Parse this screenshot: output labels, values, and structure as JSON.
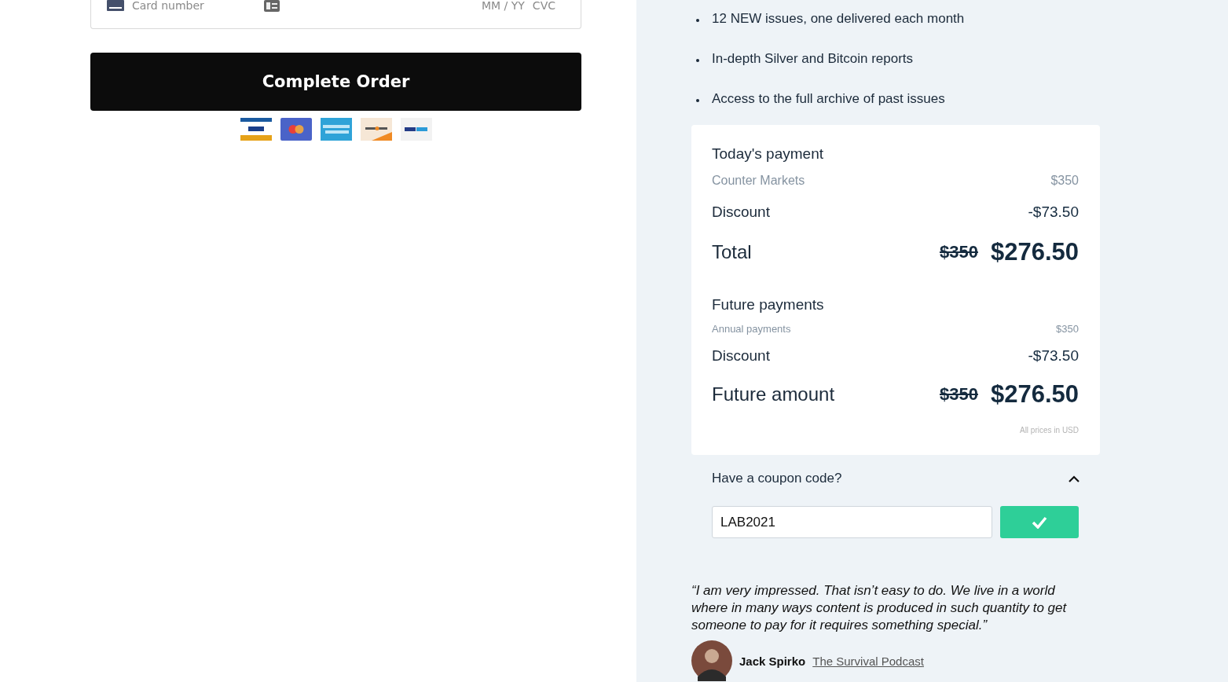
{
  "card_field": {
    "placeholder": "Card number",
    "expiry_placeholder": "MM / YY",
    "cvc_placeholder": "CVC"
  },
  "complete_button": "Complete Order",
  "payment_methods": [
    {
      "kind": "visa"
    },
    {
      "kind": "mastercard"
    },
    {
      "kind": "amex"
    },
    {
      "kind": "discover"
    },
    {
      "kind": "paypal"
    }
  ],
  "benefits": [
    "12 NEW issues, one delivered each month",
    "In-depth Silver and Bitcoin reports",
    "Access to the full archive of past issues"
  ],
  "summary": {
    "sections": [
      {
        "title": "Today's payment",
        "item": {
          "label": "Counter Markets",
          "price": "$350"
        },
        "discount": {
          "label": "Discount",
          "amount": "-$73.50"
        },
        "total": {
          "label": "Total",
          "old_price": "$350",
          "price": "$276.50"
        }
      },
      {
        "title": "Future payments",
        "item": {
          "label": "Annual payments",
          "price": "$350"
        },
        "discount": {
          "label": "Discount",
          "amount": "-$73.50"
        },
        "total": {
          "label": "Future amount",
          "old_price": "$350",
          "price": "$276.50"
        }
      }
    ],
    "note": "All prices in USD"
  },
  "coupon": {
    "label": "Have a coupon code?",
    "expanded": true,
    "value": "LAB2021"
  },
  "testimonial": {
    "quote": "“I am very impressed. That isn’t easy to do. We live in a world where in many ways content is produced in such quantity to get someone to pay for it requires something special.”",
    "author": "Jack Spirko",
    "source": "The Survival Podcast"
  }
}
